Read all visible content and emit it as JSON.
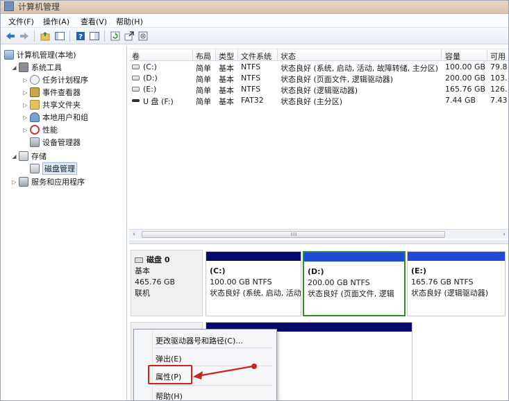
{
  "window": {
    "title": "计算机管理"
  },
  "menu": [
    "文件(F)",
    "操作(A)",
    "查看(V)",
    "帮助(H)"
  ],
  "toolbar_icons": [
    "back-arrow-icon",
    "forward-arrow-icon",
    "up-folder-icon",
    "show-hide-tree-icon",
    "help-icon",
    "properties-pane-icon",
    "refresh-icon",
    "export-icon",
    "settings-icon"
  ],
  "tree": {
    "root": "计算机管理(本地)",
    "items": [
      {
        "label": "系统工具",
        "expander": "◢",
        "level": 1
      },
      {
        "label": "任务计划程序",
        "expander": "▷",
        "level": 2
      },
      {
        "label": "事件查看器",
        "expander": "▷",
        "level": 2
      },
      {
        "label": "共享文件夹",
        "expander": "▷",
        "level": 2
      },
      {
        "label": "本地用户和组",
        "expander": "▷",
        "level": 2
      },
      {
        "label": "性能",
        "expander": "▷",
        "level": 2
      },
      {
        "label": "设备管理器",
        "expander": "",
        "level": 2
      },
      {
        "label": "存储",
        "expander": "◢",
        "level": 1
      },
      {
        "label": "磁盘管理",
        "expander": "",
        "level": 2,
        "selected": true
      },
      {
        "label": "服务和应用程序",
        "expander": "▷",
        "level": 1
      }
    ]
  },
  "volumes": {
    "columns": [
      "卷",
      "布局",
      "类型",
      "文件系统",
      "状态",
      "容量",
      "可用"
    ],
    "rows": [
      {
        "name": "(C:)",
        "layout": "简单",
        "type": "基本",
        "fs": "NTFS",
        "status": "状态良好 (系统, 启动, 活动, 故障转储, 主分区)",
        "capacity": "100.00 GB",
        "free": "79.8"
      },
      {
        "name": "(D:)",
        "layout": "简单",
        "type": "基本",
        "fs": "NTFS",
        "status": "状态良好 (页面文件, 逻辑驱动器)",
        "capacity": "200.00 GB",
        "free": "103."
      },
      {
        "name": "(E:)",
        "layout": "简单",
        "type": "基本",
        "fs": "NTFS",
        "status": "状态良好 (逻辑驱动器)",
        "capacity": "165.76 GB",
        "free": "126."
      },
      {
        "name": "U 盘 (F:)",
        "layout": "简单",
        "type": "基本",
        "fs": "FAT32",
        "status": "状态良好 (主分区)",
        "capacity": "7.44 GB",
        "free": "7.43"
      }
    ]
  },
  "scroll": {
    "left_arrow": "‹",
    "right_arrow": "›",
    "grip": "III"
  },
  "disk0": {
    "name": "磁盘 0",
    "type": "基本",
    "size": "465.76 GB",
    "state": "联机",
    "partitions": [
      {
        "label": "(C:)",
        "size": "100.00 GB NTFS",
        "status": "状态良好 (系统, 启动, 活动",
        "color": "#0a0a6e"
      },
      {
        "label": "(D:)",
        "size": "200.00 GB NTFS",
        "status": "状态良好 (页面文件, 逻辑",
        "color": "#1f4ad6"
      },
      {
        "label": "(E:)",
        "size": "165.76 GB NTFS",
        "status": "状态良好 (逻辑驱动器)",
        "color": "#1f4ad6"
      }
    ]
  },
  "context_menu": {
    "items": [
      "更改驱动器号和路径(C)...",
      "弹出(E)",
      "属性(P)",
      "帮助(H)"
    ]
  }
}
